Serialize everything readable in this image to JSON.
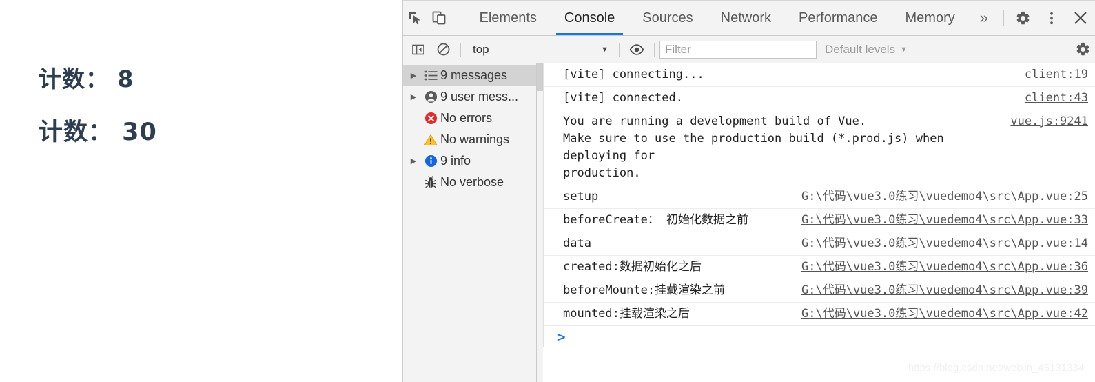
{
  "page": {
    "counters": [
      {
        "label": "计数：",
        "value": "8",
        "text": "计数： 8"
      },
      {
        "label": "计数：",
        "value": "30",
        "text": "计数： 30"
      }
    ],
    "text_color": "#2c3e50"
  },
  "devtools": {
    "tabs": [
      {
        "label": "Elements",
        "active": false
      },
      {
        "label": "Console",
        "active": true
      },
      {
        "label": "Sources",
        "active": false
      },
      {
        "label": "Network",
        "active": false
      },
      {
        "label": "Performance",
        "active": false
      },
      {
        "label": "Memory",
        "active": false
      }
    ],
    "more_tabs_label": "»",
    "accent_color": "#1a73e8",
    "left_icons": [
      {
        "name": "inspect-element-icon"
      },
      {
        "name": "device-toolbar-icon"
      }
    ],
    "right_icons": [
      {
        "name": "settings-gear-icon"
      },
      {
        "name": "more-options-icon"
      },
      {
        "name": "close-devtools-icon"
      }
    ],
    "filterbar": {
      "sidebar_toggle_icon": "show-console-sidebar-icon",
      "clear_icon": "clear-console-icon",
      "context_selected": "top",
      "context_caret": "▼",
      "eye_icon": "live-expression-icon",
      "filter_value": "",
      "filter_placeholder": "Filter",
      "levels_label": "Default levels",
      "levels_caret": "▼",
      "settings_icon": "console-settings-gear-icon"
    },
    "sidebar": [
      {
        "label": "9 messages",
        "icon": "list-icon",
        "expandable": true,
        "selected": true
      },
      {
        "label": "9 user mess...",
        "icon": "user-icon",
        "expandable": true,
        "selected": false
      },
      {
        "label": "No errors",
        "icon": "error-icon",
        "expandable": false,
        "selected": false
      },
      {
        "label": "No warnings",
        "icon": "warning-icon",
        "expandable": false,
        "selected": false
      },
      {
        "label": "9 info",
        "icon": "info-icon",
        "expandable": true,
        "selected": false
      },
      {
        "label": "No verbose",
        "icon": "verbose-bug-icon",
        "expandable": false,
        "selected": false
      }
    ],
    "messages": [
      {
        "text": "[vite] connecting...",
        "link": "client:19",
        "lines": 1
      },
      {
        "text": "[vite] connected.",
        "link": "client:43",
        "lines": 1
      },
      {
        "text": "You are running a development build of Vue.\nMake sure to use the production build (*.prod.js) when deploying for\nproduction.",
        "link": "vue.js:9241",
        "lines": 3
      },
      {
        "text": "setup",
        "link": "G:\\代码\\vue3.0练习\\vuedemo4\\src\\App.vue:25",
        "lines": 1
      },
      {
        "text": "beforeCreate： 初始化数据之前",
        "link": "G:\\代码\\vue3.0练习\\vuedemo4\\src\\App.vue:33",
        "lines": 1
      },
      {
        "text": "data",
        "link": "G:\\代码\\vue3.0练习\\vuedemo4\\src\\App.vue:14",
        "lines": 1
      },
      {
        "text": "created:数据初始化之后",
        "link": "G:\\代码\\vue3.0练习\\vuedemo4\\src\\App.vue:36",
        "lines": 1
      },
      {
        "text": "beforeMounte:挂载渲染之前",
        "link": "G:\\代码\\vue3.0练习\\vuedemo4\\src\\App.vue:39",
        "lines": 1
      },
      {
        "text": "mounted:挂载渲染之后",
        "link": "G:\\代码\\vue3.0练习\\vuedemo4\\src\\App.vue:42",
        "lines": 1
      }
    ],
    "prompt": {
      "chevron": ">",
      "value": ""
    }
  },
  "watermark": "https://blog.csdn.net/weixin_45131334"
}
